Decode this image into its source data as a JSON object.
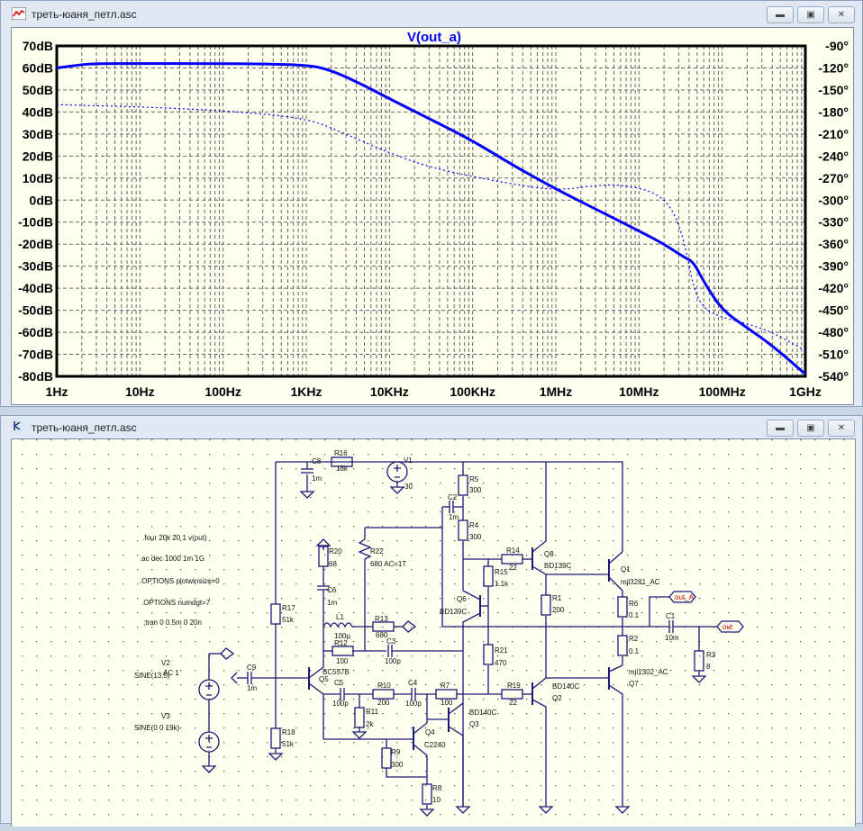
{
  "plot_window": {
    "title": "треть-юаня_петл.asc",
    "icon": "waveform-icon",
    "buttons": {
      "minimize": "minimize-icon",
      "restore": "restore-icon",
      "close": "close-icon"
    }
  },
  "schematic_window": {
    "title": "треть-юаня_петл.asc",
    "icon": "schematic-icon",
    "buttons": {
      "minimize": "minimize-icon",
      "restore": "restore-icon",
      "close": "close-icon"
    }
  },
  "chart_data": {
    "type": "line",
    "title": "V(out_a)",
    "x_scale": "log",
    "x_unit": "Hz",
    "xlim": [
      1,
      1000000000
    ],
    "x_tick_labels": [
      "1Hz",
      "10Hz",
      "100Hz",
      "1KHz",
      "10KHz",
      "100KHz",
      "1MHz",
      "10MHz",
      "100MHz",
      "1GHz"
    ],
    "ylim_left": [
      -80,
      70
    ],
    "y_left_tick_labels": [
      "70dB",
      "60dB",
      "50dB",
      "40dB",
      "30dB",
      "20dB",
      "10dB",
      "0dB",
      "-10dB",
      "-20dB",
      "-30dB",
      "-40dB",
      "-50dB",
      "-60dB",
      "-70dB",
      "-80dB"
    ],
    "ylim_right": [
      -540,
      -90
    ],
    "y_right_tick_labels": [
      "-90°",
      "-120°",
      "-150°",
      "-180°",
      "-210°",
      "-240°",
      "-270°",
      "-300°",
      "-330°",
      "-360°",
      "-390°",
      "-420°",
      "-450°",
      "-480°",
      "-510°",
      "-540°"
    ],
    "grid": true,
    "color": "#0000ff",
    "series": [
      {
        "kind": "magnitude",
        "style": "solid",
        "axis": "left",
        "x": [
          1,
          2,
          3,
          10,
          100,
          1000,
          2000,
          5000,
          10000,
          30000,
          100000,
          300000,
          1000000,
          3000000,
          10000000,
          20000000,
          35000000,
          45000000,
          60000000,
          100000000,
          200000000,
          400000000,
          1000000000
        ],
        "y": [
          60,
          61.5,
          62,
          62,
          62,
          61.5,
          59,
          52,
          46,
          37,
          27,
          16,
          5,
          -4,
          -14,
          -20,
          -26,
          -28,
          -37,
          -50,
          -58,
          -66,
          -79
        ]
      },
      {
        "kind": "phase",
        "style": "dashed",
        "axis": "right",
        "x": [
          1,
          10,
          100,
          1000,
          3000,
          10000,
          30000,
          100000,
          300000,
          1000000,
          3000000,
          6000000,
          15000000,
          25000000,
          35000000,
          45000000,
          60000000,
          100000000,
          200000000,
          400000000,
          1000000000
        ],
        "y": [
          -170,
          -173,
          -178,
          -188,
          -210,
          -236,
          -255,
          -268,
          -278,
          -287,
          -280,
          -279,
          -288,
          -310,
          -355,
          -420,
          -448,
          -460,
          -468,
          -480,
          -505
        ]
      }
    ]
  },
  "schematic": {
    "directives": [
      ".four 20k 20 1 v(out)",
      ".ac dec 1000 1m 1G",
      ".OPTIONS plotwinsize=0",
      ".OPTIONS numdgt=7",
      ";tran 0 0.5m 0 20n"
    ],
    "c8": {
      "name": "C8",
      "value": "1m"
    },
    "r16": {
      "name": "R16",
      "value": "18k"
    },
    "v1": {
      "name": "V1",
      "value": "30"
    },
    "c2": {
      "name": "C2",
      "value": "1m"
    },
    "r5": {
      "name": "R5",
      "value": "300"
    },
    "r4": {
      "name": "R4",
      "value": "300"
    },
    "r14": {
      "name": "R14",
      "value": "22"
    },
    "q8": {
      "name": "Q8",
      "value": "BD139C"
    },
    "q1": {
      "name": "Q1",
      "value": "mjl3281_AC"
    },
    "r15": {
      "name": "R15",
      "value": "1.1k"
    },
    "q6": {
      "name": "Q6",
      "value": "BD139C"
    },
    "r1": {
      "name": "R1",
      "value": "200"
    },
    "r6": {
      "name": "R6",
      "value": "0.1"
    },
    "c1": {
      "name": "C1",
      "value": "10m"
    },
    "r2": {
      "name": "R2",
      "value": "0.1"
    },
    "r3": {
      "name": "R3",
      "value": "8"
    },
    "r21": {
      "name": "R21",
      "value": "470"
    },
    "r19": {
      "name": "R19",
      "value": "22"
    },
    "q2": {
      "name": "Q2",
      "value": "BD140C"
    },
    "q7": {
      "name": "Q7",
      "value": "mjl1302_AC"
    },
    "r7": {
      "name": "R7",
      "value": "100"
    },
    "q3": {
      "name": "Q3",
      "value": "BD140C"
    },
    "r20": {
      "name": "R20",
      "value": "68"
    },
    "r22": {
      "name": "R22",
      "value": "680 AC=1T"
    },
    "c6": {
      "name": "C6",
      "value": "1m"
    },
    "l1": {
      "name": "L1",
      "value": "100µ"
    },
    "r13": {
      "name": "R13",
      "value": "680"
    },
    "r12": {
      "name": "R12",
      "value": "100"
    },
    "c3": {
      "name": "C3",
      "value": "100p"
    },
    "q5": {
      "name": "Q5",
      "value": "BC557B"
    },
    "c9": {
      "name": "C9",
      "value": "1m"
    },
    "v2": {
      "name": "V2",
      "value": "SINE(13.5)",
      "extra": "AC 1"
    },
    "v3": {
      "name": "V3",
      "value": "SINE(0 0 19k)"
    },
    "r17": {
      "name": "R17",
      "value": "51k"
    },
    "r18": {
      "name": "R18",
      "value": "51k"
    },
    "c5": {
      "name": "C5",
      "value": "100p"
    },
    "r10": {
      "name": "R10",
      "value": "200"
    },
    "c4": {
      "name": "C4",
      "value": "100p"
    },
    "r11": {
      "name": "R11",
      "value": "2k"
    },
    "q4": {
      "name": "Q4",
      "value": "C2240"
    },
    "r9": {
      "name": "R9",
      "value": "300"
    },
    "r8": {
      "name": "R8",
      "value": "10"
    },
    "labels": {
      "out_a": "out_A",
      "out": "out"
    }
  }
}
